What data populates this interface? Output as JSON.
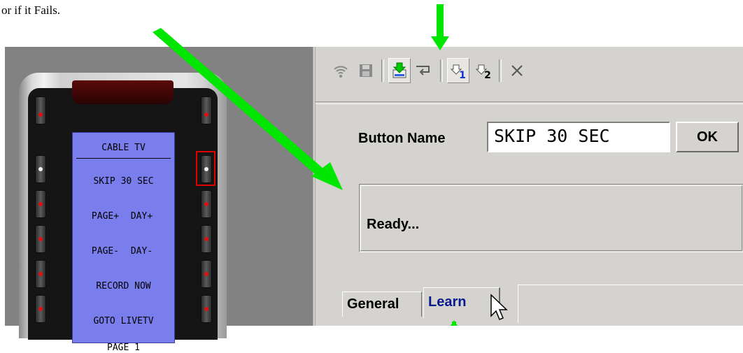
{
  "caption": "or if it Fails.",
  "remote": {
    "lcd_title": "CABLE TV",
    "lcd_rows": [
      {
        "left": "SKIP 30 SEC",
        "right": ""
      },
      {
        "left": "PAGE+",
        "right": "DAY+"
      },
      {
        "left": "PAGE-",
        "right": "DAY-"
      },
      {
        "left": "RECORD NOW",
        "right": ""
      },
      {
        "left": "GOTO LIVETV",
        "right": ""
      },
      {
        "left": "PAGE 1",
        "right": ""
      }
    ]
  },
  "toolbar": {
    "items": [
      "wifi-icon",
      "save-icon",
      "download-learn-icon",
      "redirect-icon",
      "learn-1-icon",
      "learn-2-icon",
      "delete-icon"
    ],
    "learn1_sub": "1",
    "learn2_sub": "2"
  },
  "form": {
    "button_name_label": "Button Name",
    "button_name_value": "SKIP 30 SEC",
    "ok_label": "OK",
    "status_text": "Ready..."
  },
  "tabs": [
    {
      "label": "General"
    },
    {
      "label": "Learn"
    }
  ],
  "colors": {
    "arrow": "#00e600",
    "lcd": "#7a7eec",
    "highlight": "#e00000",
    "learn_tab_text": "#0a1a8c"
  }
}
